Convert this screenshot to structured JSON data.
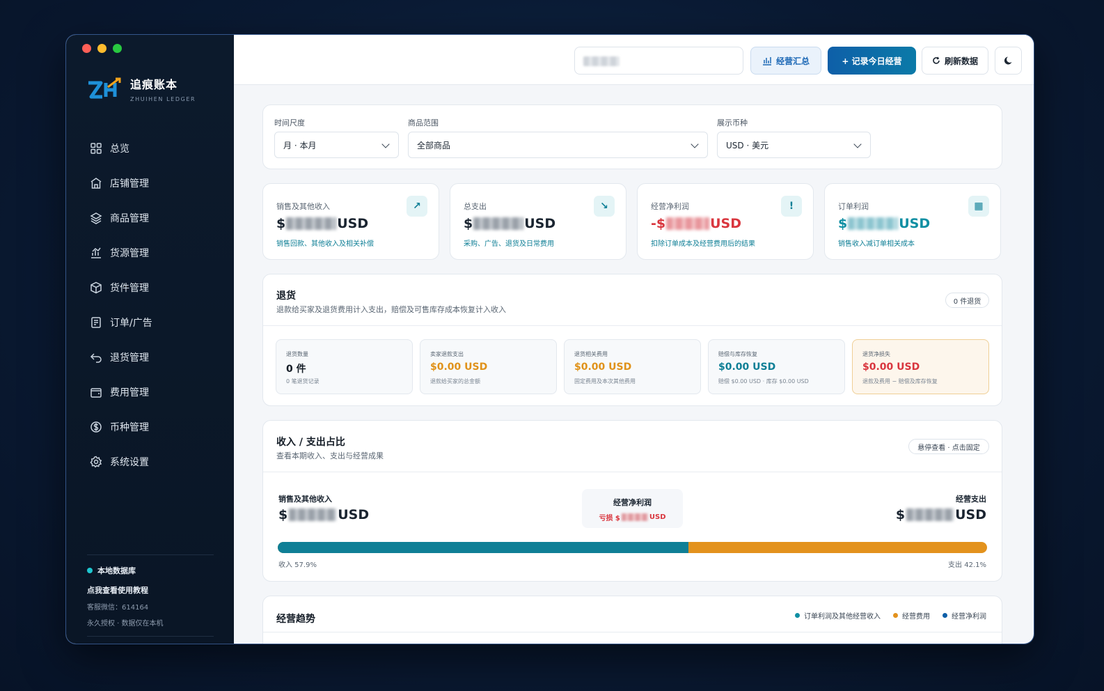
{
  "app": {
    "name": "追痕账本",
    "subtitle": "ZHUIHEN LEDGER"
  },
  "sidebar": {
    "items": [
      {
        "label": "总览",
        "icon": "grid-icon"
      },
      {
        "label": "店铺管理",
        "icon": "store-icon"
      },
      {
        "label": "商品管理",
        "icon": "layers-icon"
      },
      {
        "label": "货源管理",
        "icon": "chart-icon"
      },
      {
        "label": "货件管理",
        "icon": "box-icon"
      },
      {
        "label": "订单/广告",
        "icon": "receipt-icon"
      },
      {
        "label": "退货管理",
        "icon": "return-icon"
      },
      {
        "label": "费用管理",
        "icon": "wallet-icon"
      },
      {
        "label": "币种管理",
        "icon": "dollar-icon"
      },
      {
        "label": "系统设置",
        "icon": "gear-icon"
      }
    ],
    "footer": {
      "db": "本地数据库",
      "tutorial": "点我查看使用教程",
      "wechat": "客服微信：614164",
      "license": "永久授权 · 数据仅在本机"
    }
  },
  "topbar": {
    "summary_label": "经营汇总",
    "record_label": "+ 记录今日经营",
    "refresh_label": "刷新数据"
  },
  "filters": {
    "time_label": "时间尺度",
    "time_value": "月 · 本月",
    "product_label": "商品范围",
    "product_value": "全部商品",
    "currency_label": "展示币种",
    "currency_value": "USD · 美元"
  },
  "kpis": [
    {
      "title": "销售及其他收入",
      "prefix": "$",
      "suffix": "USD",
      "desc": "销售回款、其他收入及相关补偿",
      "icon": "↗",
      "color": "#0f7f96",
      "desc_color": "#0f7f96"
    },
    {
      "title": "总支出",
      "prefix": "$",
      "suffix": "USD",
      "desc": "采购、广告、退货及日常费用",
      "icon": "↘",
      "color": "#1a2430",
      "desc_color": "#0f7f96"
    },
    {
      "title": "经营净利润",
      "prefix": "-$",
      "suffix": "USD",
      "desc": "扣除订单成本及经营费用后的结果",
      "icon": "!",
      "color": "#d9363e",
      "desc_color": "#0f7f96"
    },
    {
      "title": "订单利润",
      "prefix": "$",
      "suffix": "USD",
      "desc": "销售收入减订单相关成本",
      "icon": "▦",
      "color": "#0f8fa3",
      "desc_color": "#0f7f96"
    }
  ],
  "returns": {
    "title": "退货",
    "subtitle": "退款给买家及退货费用计入支出，赔偿及可售库存成本恢复计入收入",
    "badge": "0 件退货",
    "boxes": [
      {
        "title": "退货数量",
        "value": "0 件",
        "desc": "0 笔退货记录",
        "color": "#141c26"
      },
      {
        "title": "卖家退款支出",
        "value": "$0.00 USD",
        "desc": "退款给买家的总金额",
        "color": "#e0921a"
      },
      {
        "title": "退货相关费用",
        "value": "$0.00 USD",
        "desc": "固定费用及本次其他费用",
        "color": "#e0921a"
      },
      {
        "title": "赔偿与库存恢复",
        "value": "$0.00 USD",
        "desc": "赔偿 $0.00 USD · 库存 $0.00 USD",
        "color": "#0f7f96"
      },
      {
        "title": "退货净损失",
        "value": "$0.00 USD",
        "desc": "退款及费用 − 赔偿及库存恢复",
        "color": "#d9363e"
      }
    ]
  },
  "ratio": {
    "title": "收入 / 支出占比",
    "subtitle": "查看本期收入、支出与经营成果",
    "badge": "悬停查看 · 点击固定",
    "income_label": "销售及其他收入",
    "income_prefix": "$",
    "income_suffix": "USD",
    "expense_label": "经营支出",
    "expense_prefix": "$",
    "expense_suffix": "USD",
    "net_label": "经营净利润",
    "net_prefix": "亏损 $",
    "net_suffix": "USD",
    "income_pct_label": "收入 57.9%",
    "expense_pct_label": "支出 42.1%",
    "income_fraction": 0.579,
    "income_color": "#0f7f96",
    "expense_color": "#e3921d"
  },
  "trend": {
    "title": "经营趋势",
    "legend": [
      {
        "label": "订单利润及其他经营收入",
        "color": "#0f8fa3"
      },
      {
        "label": "经营费用",
        "color": "#e3921d"
      },
      {
        "label": "经营净利润",
        "color": "#0e5fa8"
      }
    ]
  }
}
